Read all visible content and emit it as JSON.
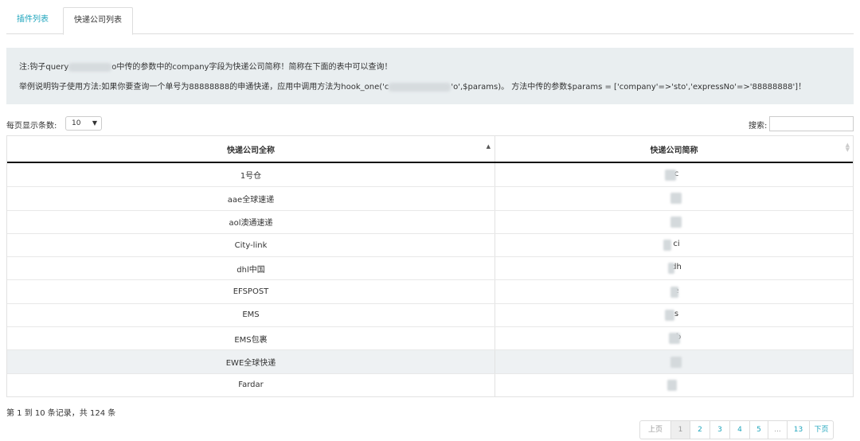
{
  "tabs": [
    {
      "label": "插件列表",
      "active": false
    },
    {
      "label": "快递公司列表",
      "active": true
    }
  ],
  "notice": {
    "line1_prefix": "注:钩子query",
    "line1_suffix": "o中传的参数中的company字段为快递公司简称！简称在下面的表中可以查询！",
    "line2_prefix": "举例说明钩子使用方法:如果你要查询一个单号为88888888的申通快递，应用中调用方法为hook_one('c",
    "line2_mid": "'o',$params)。 方法中传的参数$params = ['company'=>'sto','expressNo'=>'88888888']！"
  },
  "controls": {
    "page_length_label": "每页显示条数:",
    "page_length_value": "10",
    "page_length_caret": "▼",
    "search_label": "搜索:",
    "search_value": ""
  },
  "table": {
    "headers": [
      "快递公司全称",
      "快递公司简称"
    ],
    "sort_asc_glyph": "▲",
    "sort_both_glyph": "▲▼",
    "rows": [
      {
        "name": "1号仓",
        "abbr": "c",
        "highlight": false
      },
      {
        "name": "aae全球速递",
        "abbr": "a",
        "highlight": false
      },
      {
        "name": "aol澳通速递",
        "abbr": "a",
        "highlight": false
      },
      {
        "name": "City-link",
        "abbr": "ci",
        "highlight": false
      },
      {
        "name": "dhl中国",
        "abbr": "dh",
        "highlight": false
      },
      {
        "name": "EFSPOST",
        "abbr": "e",
        "highlight": false
      },
      {
        "name": "EMS",
        "abbr": "s",
        "highlight": false
      },
      {
        "name": "EMS包裹",
        "abbr": "sb",
        "highlight": false
      },
      {
        "name": "EWE全球快递",
        "abbr": "e",
        "highlight": true
      },
      {
        "name": "Fardar",
        "abbr": "",
        "highlight": false
      }
    ]
  },
  "footer": {
    "info": "第 1 到 10 条记录，共 124 条",
    "pager": [
      "上页",
      "1",
      "2",
      "3",
      "4",
      "5",
      "...",
      "13",
      "下页"
    ]
  },
  "colors": {
    "accent": "#1fa5bd",
    "notice_bg": "#e9eef0",
    "highlight_row": "#eef1f3"
  }
}
